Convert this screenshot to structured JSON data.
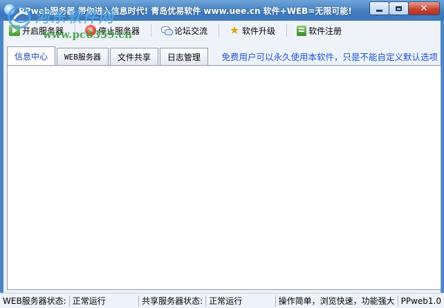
{
  "window": {
    "title": "PPweb服务器 带你进入信息时代! 青岛优易软件 www.uee.cn 软件+WEB=无限可能!"
  },
  "toolbar": {
    "start_label": "开启服务器",
    "stop_label": "停止服务器",
    "forum_label": "论坛交流",
    "upgrade_label": "软件升级",
    "register_label": "软件注册"
  },
  "tabs": [
    {
      "label": "信息中心",
      "active": true
    },
    {
      "label": "WEB服务器",
      "active": false
    },
    {
      "label": "文件共享",
      "active": false
    },
    {
      "label": "日志管理",
      "active": false
    }
  ],
  "notice": "免费用户可以永久使用本软件，只是不能自定义默认选项",
  "statusbar": {
    "web_status_label": "WEB服务器状态:",
    "web_status_value": "正常运行",
    "share_status_label": "共享服务器状态:",
    "share_status_value": "正常运行",
    "slogan": "操作简单，浏览快速，功能强大",
    "version": "PPweb1.0"
  },
  "watermark": {
    "site_name": "河东软件网",
    "url": "www.pc0359.cn"
  },
  "colors": {
    "title_bar": "#3f7cbf",
    "notice_text": "#1e53d6",
    "active_tab_text": "#1a3fb0"
  }
}
